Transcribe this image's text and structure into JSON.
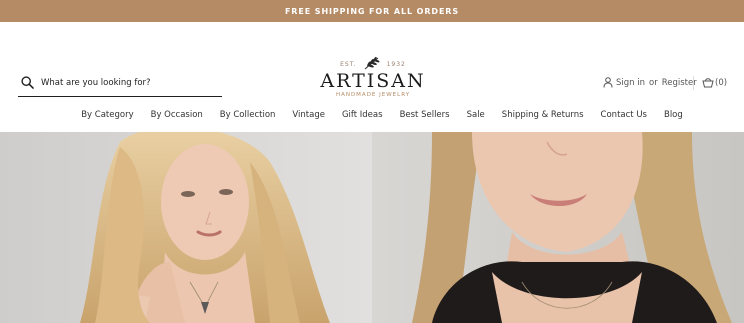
{
  "promo": {
    "text": "FREE SHIPPING FOR ALL ORDERS"
  },
  "search": {
    "placeholder": "What are you looking for?",
    "icon": "search-icon"
  },
  "logo": {
    "est": "EST.",
    "year": "1932",
    "name": "ARTISAN",
    "tagline": "HANDMADE JEWELRY"
  },
  "account": {
    "sign_in": "Sign in",
    "or": "or",
    "register": "Register"
  },
  "cart": {
    "count": "(0)"
  },
  "nav": {
    "items": [
      {
        "label": "By Category"
      },
      {
        "label": "By Occasion"
      },
      {
        "label": "By Collection"
      },
      {
        "label": "Vintage"
      },
      {
        "label": "Gift Ideas"
      },
      {
        "label": "Best Sellers"
      },
      {
        "label": "Sale"
      },
      {
        "label": "Shipping & Returns"
      },
      {
        "label": "Contact Us"
      },
      {
        "label": "Blog"
      }
    ]
  },
  "colors": {
    "promo_bg": "#b58b66",
    "accent": "#b58b66",
    "text": "#2b2b2b"
  }
}
